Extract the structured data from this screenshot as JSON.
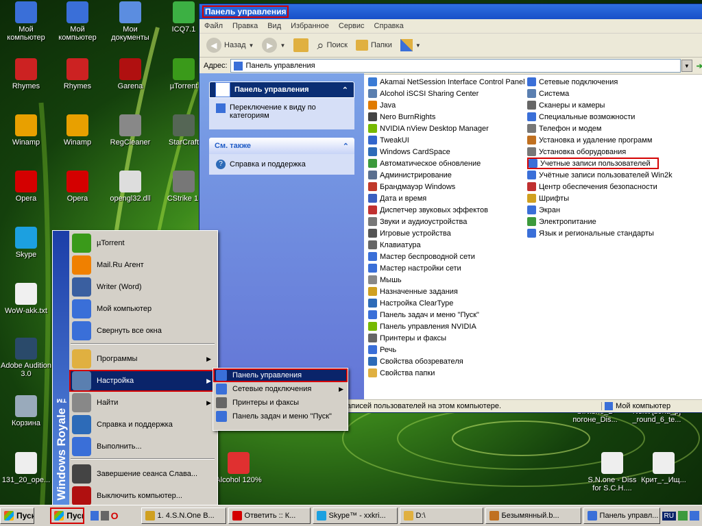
{
  "desktop": {
    "icons": [
      {
        "label": "Мой компьютер",
        "icon": "computer-icon",
        "color": "#3a6fd8"
      },
      {
        "label": "Мой компьютер",
        "icon": "computer-icon",
        "color": "#3a6fd8"
      },
      {
        "label": "Мои документы",
        "icon": "documents-icon",
        "color": "#5b8de0"
      },
      {
        "label": "ICQ7.1",
        "icon": "icq-icon",
        "color": "#3cb043"
      },
      {
        "label": "Rhymes",
        "icon": "rhymes-icon",
        "color": "#cc2222"
      },
      {
        "label": "Rhymes",
        "icon": "rhymes-icon",
        "color": "#cc2222"
      },
      {
        "label": "Garena",
        "icon": "garena-icon",
        "color": "#b01010"
      },
      {
        "label": "µTorrent",
        "icon": "utorrent-icon",
        "color": "#3a9a1a"
      },
      {
        "label": "Winamp",
        "icon": "winamp-icon",
        "color": "#e8a000"
      },
      {
        "label": "Winamp",
        "icon": "winamp-icon",
        "color": "#e8a000"
      },
      {
        "label": "RegCleaner",
        "icon": "regcleaner-icon",
        "color": "#888888"
      },
      {
        "label": "StarCraft",
        "icon": "starcraft-icon",
        "color": "#556655"
      },
      {
        "label": "Opera",
        "icon": "opera-icon",
        "color": "#d40000"
      },
      {
        "label": "Opera",
        "icon": "opera-icon",
        "color": "#d40000"
      },
      {
        "label": "opengl32.dll",
        "icon": "dll-file-icon",
        "color": "#dddddd"
      },
      {
        "label": "CStrike 1.",
        "icon": "cstrike-icon",
        "color": "#777777"
      },
      {
        "label": "Skype",
        "icon": "skype-icon",
        "color": "#1ca0e0"
      },
      {
        "label": "WoW-akk.txt",
        "icon": "text-file-icon",
        "color": "#f0f0f0"
      },
      {
        "label": "Adobe Audition 3.0",
        "icon": "audition-icon",
        "color": "#2a4a6a"
      },
      {
        "label": "Корзина",
        "icon": "recycle-bin-icon",
        "color": "#9ab"
      },
      {
        "label": "131_20_ope...",
        "icon": "file-icon",
        "color": "#eeeeee"
      },
      {
        "label": "Alcohol 120%",
        "icon": "alcohol-icon",
        "color": "#e03030"
      },
      {
        "label": "S.N.one_B погоне_Dis...",
        "icon": "file-icon",
        "color": "#eeeeee"
      },
      {
        "label": "Nekit [zona_p] _round_6_te...",
        "icon": "file-icon",
        "color": "#eeeeee"
      },
      {
        "label": "S.N.one - Diss for S.C.H....",
        "icon": "audio-file-icon",
        "color": "#eeeeee"
      },
      {
        "label": "Крит_-_Ищ...",
        "icon": "audio-file-icon",
        "color": "#eeeeee"
      }
    ]
  },
  "window": {
    "title": "Панель управления",
    "menu": [
      "Файл",
      "Правка",
      "Вид",
      "Избранное",
      "Сервис",
      "Справка"
    ],
    "toolbar": {
      "back": "Назад",
      "search": "Поиск",
      "folders": "Папки"
    },
    "address_label": "Адрес:",
    "address_value": "Панель управления",
    "left": {
      "panel_title": "Панель управления",
      "switch_link": "Переключение к виду по категориям",
      "see_also_title": "См. также",
      "help_link": "Справка и поддержка"
    },
    "items_col1": [
      {
        "label": "Akamai NetSession Interface Control Panel",
        "color": "#3a7bd5"
      },
      {
        "label": "Alcohol iSCSI Sharing Center",
        "color": "#5a7fb0"
      },
      {
        "label": "Java",
        "color": "#e07b00"
      },
      {
        "label": "Nero BurnRights",
        "color": "#444444"
      },
      {
        "label": "NVIDIA nView Desktop Manager",
        "color": "#76b900"
      },
      {
        "label": "TweakUI",
        "color": "#3366cc"
      },
      {
        "label": "Windows CardSpace",
        "color": "#2d6bb8"
      },
      {
        "label": "Автоматическое обновление",
        "color": "#3c9a3c"
      },
      {
        "label": "Администрирование",
        "color": "#5a6f8f"
      },
      {
        "label": "Брандмауэр Windows",
        "color": "#c0392b"
      },
      {
        "label": "Дата и время",
        "color": "#3a5fc0"
      },
      {
        "label": "Диспетчер звуковых эффектов",
        "color": "#c03030"
      },
      {
        "label": "Звуки и аудиоустройства",
        "color": "#777777"
      },
      {
        "label": "Игровые устройства",
        "color": "#555555"
      },
      {
        "label": "Клавиатура",
        "color": "#666666"
      },
      {
        "label": "Мастер беспроводной сети",
        "color": "#3a6fd8"
      },
      {
        "label": "Мастер настройки сети",
        "color": "#3a6fd8"
      },
      {
        "label": "Мышь",
        "color": "#888888"
      },
      {
        "label": "Назначенные задания",
        "color": "#d0a020"
      },
      {
        "label": "Настройка ClearType",
        "color": "#2d6bb8"
      },
      {
        "label": "Панель задач и меню \"Пуск\"",
        "color": "#3a6fd8"
      },
      {
        "label": "Панель управления NVIDIA",
        "color": "#76b900"
      },
      {
        "label": "Принтеры и факсы",
        "color": "#666666"
      },
      {
        "label": "Речь",
        "color": "#3a6fd8"
      },
      {
        "label": "Свойства обозревателя",
        "color": "#2d6bb8"
      },
      {
        "label": "Свойства папки",
        "color": "#e0b040"
      }
    ],
    "items_col2": [
      {
        "label": "Сетевые подключения",
        "color": "#3a6fd8"
      },
      {
        "label": "Система",
        "color": "#5a7fb0"
      },
      {
        "label": "Сканеры и камеры",
        "color": "#666666"
      },
      {
        "label": "Специальные возможности",
        "color": "#3a6fd8"
      },
      {
        "label": "Телефон и модем",
        "color": "#777777"
      },
      {
        "label": "Установка и удаление программ",
        "color": "#c07020"
      },
      {
        "label": "Установка оборудования",
        "color": "#777777"
      },
      {
        "label": "Учетные записи пользователей",
        "color": "#3a6fd8"
      },
      {
        "label": "Учётные записи пользователей Win2k",
        "color": "#3a6fd8"
      },
      {
        "label": "Центр обеспечения безопасности",
        "color": "#c03030"
      },
      {
        "label": "Шрифты",
        "color": "#d0a020"
      },
      {
        "label": "Экран",
        "color": "#3a6fd8"
      },
      {
        "label": "Электропитание",
        "color": "#3c9a3c"
      },
      {
        "label": "Язык и региональные стандарты",
        "color": "#3a6fd8"
      }
    ],
    "status_text": "записей пользователей на этом компьютере.",
    "status_zone": "Мой компьютер"
  },
  "startmenu": {
    "side_text": "Windows Royale ™",
    "items": [
      {
        "label": "µTorrent",
        "icon": "utorrent-icon",
        "color": "#3a9a1a",
        "arrow": false
      },
      {
        "label": "Mail.Ru Агент",
        "icon": "mailru-agent-icon",
        "color": "#f08000",
        "arrow": false
      },
      {
        "label": "Writer (Word)",
        "icon": "writer-icon",
        "color": "#3a5fa0",
        "arrow": false
      },
      {
        "label": "Мой компьютер",
        "icon": "computer-icon",
        "color": "#3a6fd8",
        "arrow": false
      },
      {
        "label": "Свернуть все окна",
        "icon": "show-desktop-icon",
        "color": "#3a6fd8",
        "arrow": false
      },
      {
        "label": "Программы",
        "icon": "programs-folder-icon",
        "color": "#e0b040",
        "arrow": true
      },
      {
        "label": "Настройка",
        "icon": "settings-icon",
        "color": "#5a7fb0",
        "arrow": true
      },
      {
        "label": "Найти",
        "icon": "search-icon",
        "color": "#888888",
        "arrow": true
      },
      {
        "label": "Справка и поддержка",
        "icon": "help-icon",
        "color": "#2d6bb8",
        "arrow": false
      },
      {
        "label": "Выполнить...",
        "icon": "run-icon",
        "color": "#3a6fd8",
        "arrow": false
      },
      {
        "label": "Завершение сеанса Слава...",
        "icon": "logoff-icon",
        "color": "#444444",
        "arrow": false
      },
      {
        "label": "Выключить компьютер...",
        "icon": "shutdown-icon",
        "color": "#b01010",
        "arrow": false
      }
    ]
  },
  "submenu": {
    "items": [
      {
        "label": "Панель управления",
        "color": "#3a6fd8",
        "arrow": false
      },
      {
        "label": "Сетевые подключения",
        "color": "#3a6fd8",
        "arrow": true
      },
      {
        "label": "Принтеры и факсы",
        "color": "#666666",
        "arrow": false
      },
      {
        "label": "Панель задач и меню \"Пуск\"",
        "color": "#3a6fd8",
        "arrow": false
      }
    ]
  },
  "taskbar": {
    "start1": "Пуск",
    "start2": "Пуск",
    "tasks": [
      {
        "label": "1. 4.S.N.One B...",
        "color": "#d0a020"
      },
      {
        "label": "Ответить :: К...",
        "color": "#d40000"
      },
      {
        "label": "Skype™ - xxkri...",
        "color": "#1ca0e0"
      },
      {
        "label": "D:\\",
        "color": "#e0b040"
      },
      {
        "label": "Безымянный.b...",
        "color": "#c07020"
      },
      {
        "label": "Панель управл...",
        "color": "#3a6fd8"
      }
    ],
    "lang": "RU"
  }
}
